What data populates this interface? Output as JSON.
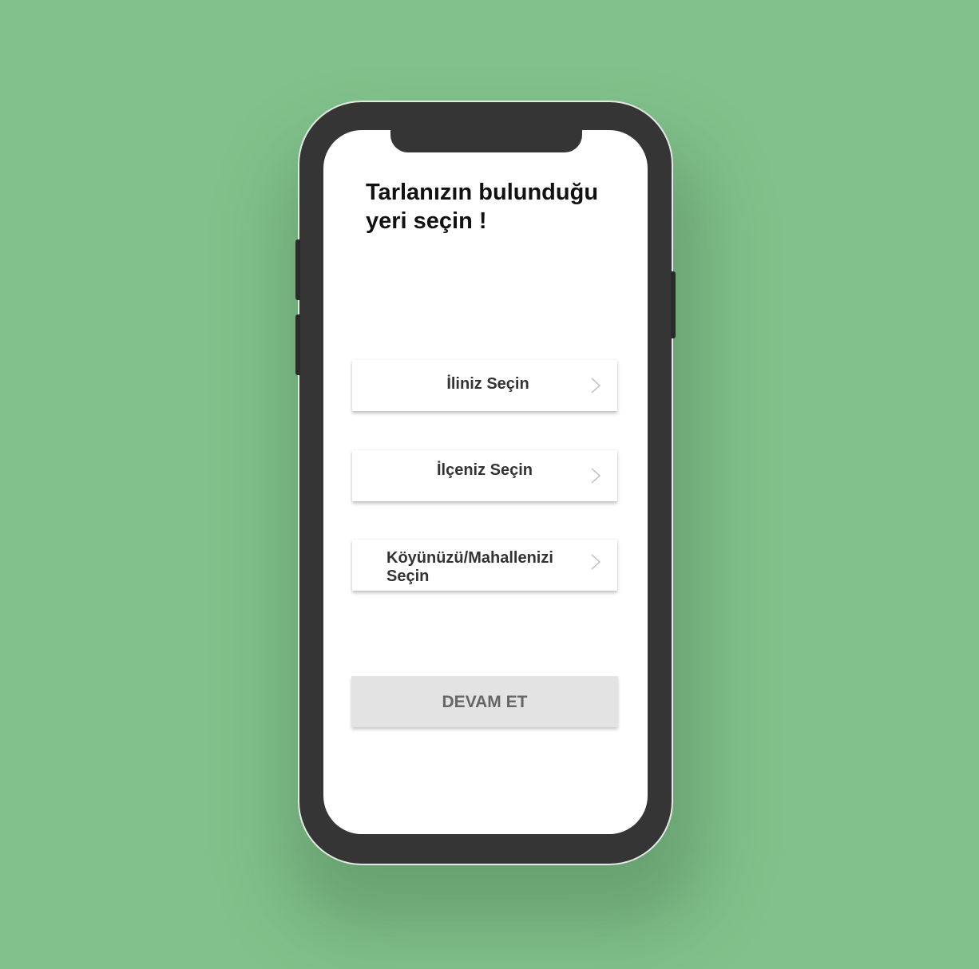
{
  "background_color": "#81c18b",
  "screen": {
    "title": "Tarlanızın bulunduğu yeri seçin !",
    "province_select": {
      "label": "İliniz Seçin",
      "icon": "chevron-right-icon"
    },
    "district_select": {
      "label": "İlçeniz Seçin",
      "icon": "chevron-right-icon"
    },
    "village_select": {
      "label": "Köyünüzü/Mahallenizi Seçin",
      "icon": "chevron-right-icon"
    },
    "continue_button": {
      "label": "DEVAM ET",
      "color": "#e3e3e3"
    }
  }
}
